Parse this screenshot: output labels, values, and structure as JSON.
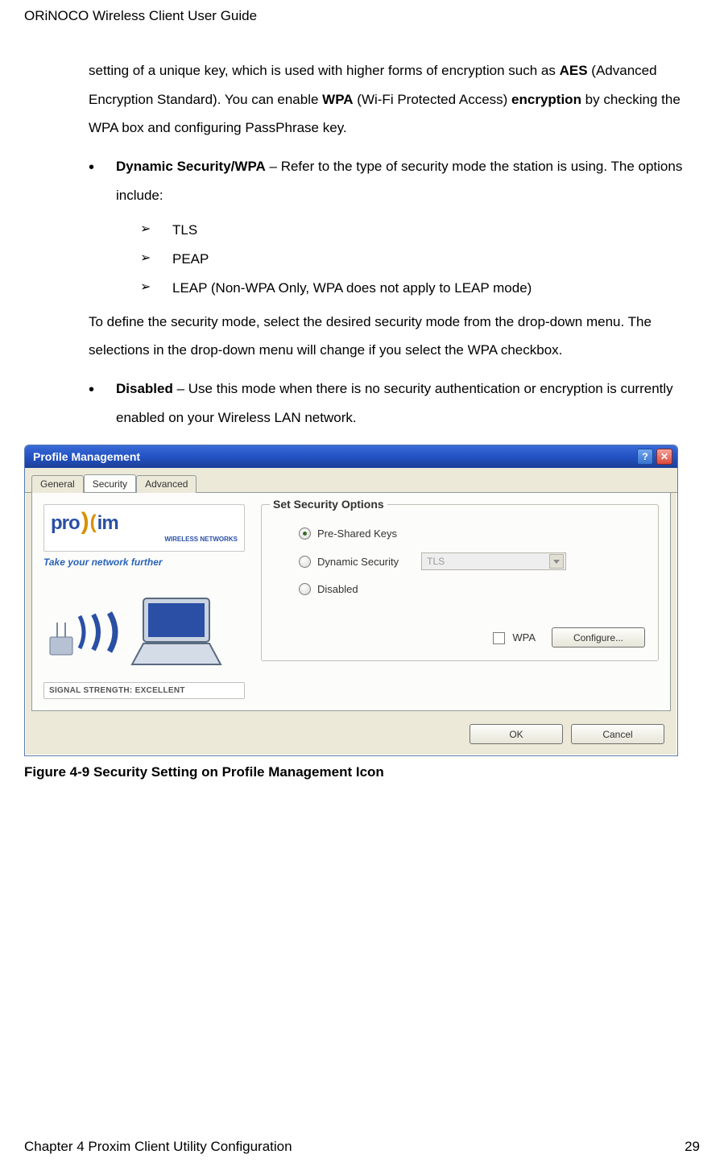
{
  "header": {
    "guide_title": "ORiNOCO Wireless Client User Guide"
  },
  "intro": {
    "line1a": "setting of a unique key, which is used with higher forms of encryption such as ",
    "aes": "AES",
    "line1b": " (Advanced Encryption Standard). You can enable ",
    "wpa": "WPA",
    "line1c": " (Wi-Fi Protected Access) ",
    "encryption": "encryption",
    "line1d": " by checking the WPA box and configuring PassPhrase key."
  },
  "bullets": {
    "b1_title": "Dynamic Security/WPA",
    "b1_text": " – Refer to the type of security mode the station is using. The options include:",
    "sub": {
      "s1": "TLS",
      "s2": "PEAP",
      "s3": "LEAP (Non-WPA Only, WPA does not apply to LEAP mode)"
    },
    "b1_after": "To define the security mode, select the desired security mode from the drop-down menu. The selections in the drop-down menu will change if you select the WPA checkbox.",
    "b2_title": "Disabled",
    "b2_text": " – Use this mode when there is no security authentication or encryption is currently enabled on your Wireless LAN network."
  },
  "dialog": {
    "title": "Profile Management",
    "tabs": {
      "general": "General",
      "security": "Security",
      "advanced": "Advanced"
    },
    "brand": {
      "name_left": "pro",
      "name_right": "im",
      "sub": "WIRELESS NETWORKS",
      "tagline": "Take your network further"
    },
    "signal": {
      "label": "SIGNAL STRENGTH:",
      "value": "EXCELLENT"
    },
    "group": {
      "title": "Set Security Options",
      "opt1": "Pre-Shared Keys",
      "opt2": "Dynamic Security",
      "opt3": "Disabled",
      "combo_value": "TLS",
      "wpa_label": "WPA",
      "configure": "Configure..."
    },
    "buttons": {
      "ok": "OK",
      "cancel": "Cancel"
    }
  },
  "figure": {
    "caption": "Figure 4-9  Security Setting on Profile Management Icon"
  },
  "footer": {
    "chapter": "Chapter 4 Proxim Client Utility Configuration",
    "page": "29"
  }
}
